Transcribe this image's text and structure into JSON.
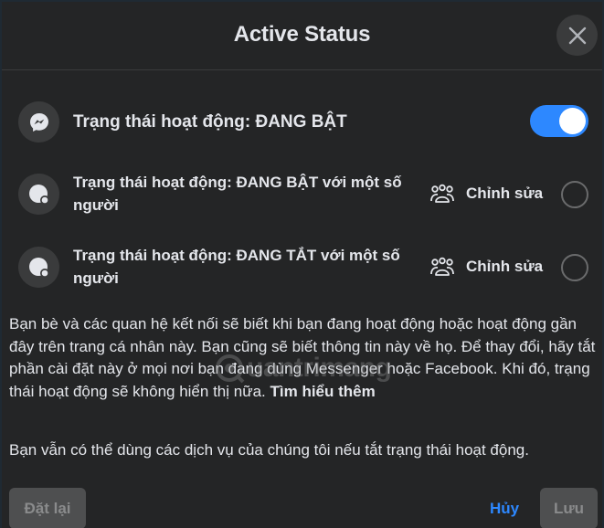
{
  "header": {
    "title": "Active Status",
    "close_icon": "close-icon"
  },
  "options": [
    {
      "icon": "messenger-icon",
      "label": "Trạng thái hoạt động: ĐANG BẬT",
      "control": "toggle",
      "toggle_on": true
    },
    {
      "icon": "active-some-people-icon",
      "label": "Trạng thái hoạt động: ĐANG BẬT với một số người",
      "edit_icon": "people-group-icon",
      "edit_label": "Chỉnh sửa",
      "control": "radio",
      "selected": false
    },
    {
      "icon": "inactive-some-people-icon",
      "label": "Trạng thái hoạt động: ĐANG TẮT với một số người",
      "edit_icon": "people-group-icon",
      "edit_label": "Chỉnh sửa",
      "control": "radio",
      "selected": false
    }
  ],
  "description": {
    "paragraph1": "Bạn bè và các quan hệ kết nối sẽ biết khi bạn đang hoạt động hoặc hoạt động gần đây trên trang cá nhân này. Bạn cũng sẽ biết thông tin này về họ. Để thay đổi, hãy tắt phần cài đặt này ở mọi nơi bạn đang dùng Messenger hoặc Facebook. Khi đó, trạng thái hoạt động sẽ không hiển thị nữa.",
    "learn_more": "Tìm hiểu thêm",
    "paragraph2": "Bạn vẫn có thể dùng các dịch vụ của chúng tôi nếu tắt trạng thái hoạt động."
  },
  "watermark": {
    "text": "uantrimang"
  },
  "footer": {
    "reset_label": "Đặt lại",
    "cancel_label": "Hủy",
    "save_label": "Lưu"
  },
  "colors": {
    "background": "#242526",
    "accent": "#2d88ff",
    "icon_bg": "#3a3b3c",
    "text": "#e4e6eb",
    "disabled_button": "#4e4f50"
  }
}
